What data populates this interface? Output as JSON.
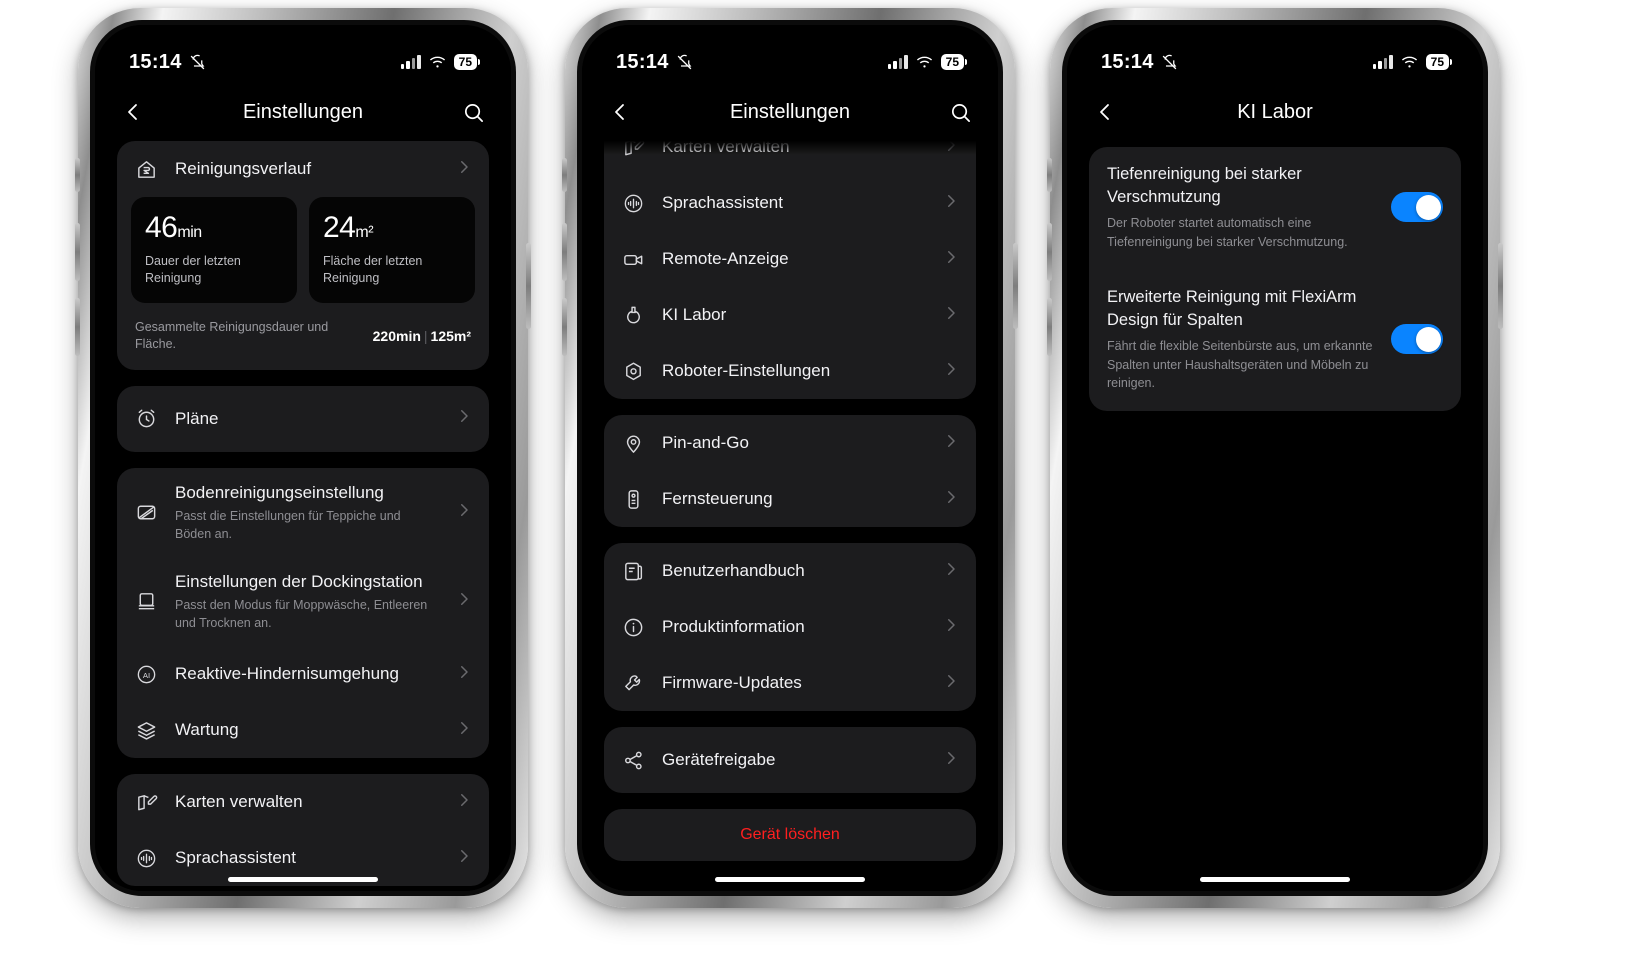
{
  "statusbar": {
    "time": "15:14",
    "mute_icon": "bell-slash-icon",
    "signal_icon": "cellular-bars-icon",
    "wifi_icon": "wifi-icon",
    "battery_level": "75"
  },
  "phone1": {
    "nav": {
      "back": "back-chevron-icon",
      "title": "Einstellungen",
      "search": "search-icon"
    },
    "history": {
      "title": "Reinigungsverlauf",
      "icon": "home-history-icon",
      "stats": [
        {
          "value": "46",
          "unit": "min",
          "label": "Dauer der letzten Reinigung"
        },
        {
          "value": "24",
          "unit": "m²",
          "label": "Fläche der letzten Reinigung"
        }
      ],
      "total_label": "Gesammelte Reinigungsdauer und Fläche.",
      "total_time": "220min",
      "total_area": "125m²"
    },
    "plans": {
      "title": "Pläne",
      "icon": "alarm-clock-icon"
    },
    "settings_group": [
      {
        "title": "Bodenreinigungseinstellung",
        "sub": "Passt die Einstellungen für Teppiche und Böden an.",
        "icon": "carpet-icon"
      },
      {
        "title": "Einstellungen der Dockingstation",
        "sub": "Passt den Modus für Moppwäsche, Entleeren und Trocknen an.",
        "icon": "dock-station-icon"
      },
      {
        "title": "Reaktive-Hindernisumgehung",
        "sub": "",
        "icon": "ai-circle-icon"
      },
      {
        "title": "Wartung",
        "sub": "",
        "icon": "layers-icon"
      }
    ],
    "maps_group": [
      {
        "title": "Karten verwalten",
        "icon": "map-edit-icon"
      },
      {
        "title": "Sprachassistent",
        "icon": "voice-assistant-icon"
      }
    ]
  },
  "phone2": {
    "nav": {
      "back": "back-chevron-icon",
      "title": "Einstellungen",
      "search": "search-icon"
    },
    "group1": [
      {
        "title": "Karten verwalten",
        "icon": "map-edit-icon"
      },
      {
        "title": "Sprachassistent",
        "icon": "voice-assistant-icon"
      },
      {
        "title": "Remote-Anzeige",
        "icon": "video-camera-icon"
      },
      {
        "title": "KI Labor",
        "icon": "flask-icon"
      },
      {
        "title": "Roboter-Einstellungen",
        "icon": "robot-gear-icon"
      }
    ],
    "group2": [
      {
        "title": "Pin-and-Go",
        "icon": "map-pin-icon"
      },
      {
        "title": "Fernsteuerung",
        "icon": "remote-control-icon"
      }
    ],
    "group3": [
      {
        "title": "Benutzerhandbuch",
        "icon": "manual-book-icon"
      },
      {
        "title": "Produktinformation",
        "icon": "info-circle-icon"
      },
      {
        "title": "Firmware-Updates",
        "icon": "wrench-icon"
      }
    ],
    "group4": [
      {
        "title": "Gerätefreigabe",
        "icon": "share-icon"
      }
    ],
    "delete_label": "Gerät löschen",
    "delete_color": "#ff1f1f"
  },
  "phone3": {
    "nav": {
      "back": "back-chevron-icon",
      "title": "KI Labor"
    },
    "toggles": [
      {
        "title": "Tiefenreinigung bei starker Verschmutzung",
        "sub": "Der Roboter startet automatisch eine Tiefenreinigung bei starker Verschmutzung.",
        "state": "on"
      },
      {
        "title": "Erweiterte Reinigung mit FlexiArm Design für Spalten",
        "sub": "Fährt die flexible Seitenbürste aus, um erkannte Spalten unter Haushaltsgeräten und Möbeln zu reinigen.",
        "state": "on"
      }
    ],
    "accent_color": "#0a84ff"
  }
}
